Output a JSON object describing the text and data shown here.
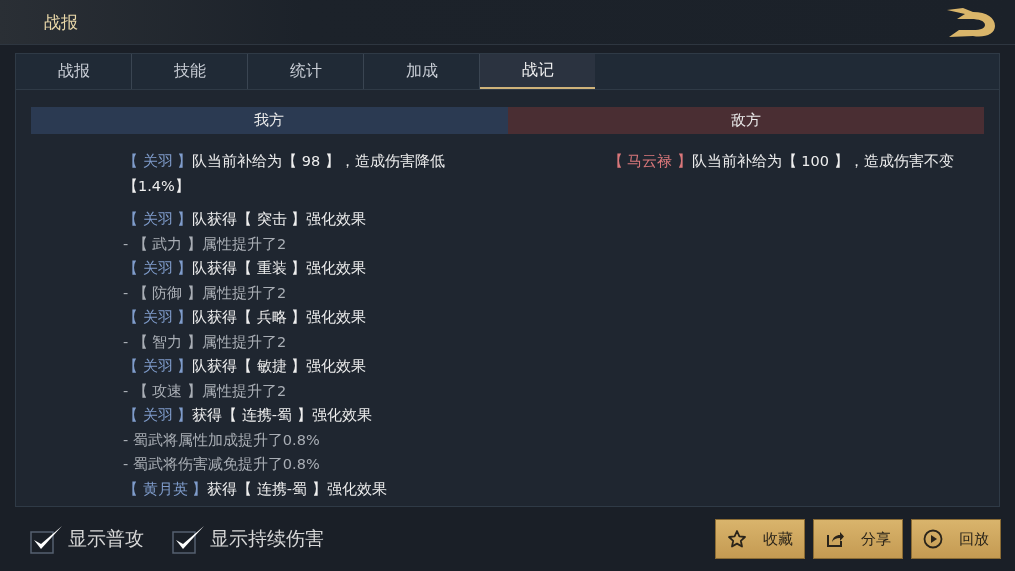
{
  "header": {
    "title": "战报"
  },
  "tabs": [
    {
      "label": "战报",
      "selected": false
    },
    {
      "label": "技能",
      "selected": false
    },
    {
      "label": "统计",
      "selected": false
    },
    {
      "label": "加成",
      "selected": false
    },
    {
      "label": "战记",
      "selected": true
    }
  ],
  "sides": [
    {
      "kind": "ally",
      "heading": "我方",
      "entries": [
        {
          "kind": "event",
          "name": "【 关羽 】",
          "text": "队当前补给为【 98 】，造成伤害降低【1.4%】"
        },
        {
          "kind": "event",
          "name": "【 关羽 】",
          "text": "队获得【 突击 】强化效果"
        },
        {
          "kind": "detail",
          "text": "- 【 武力 】属性提升了2"
        },
        {
          "kind": "event",
          "name": "【 关羽 】",
          "text": "队获得【 重装 】强化效果"
        },
        {
          "kind": "detail",
          "text": "- 【 防御 】属性提升了2"
        },
        {
          "kind": "event",
          "name": "【 关羽 】",
          "text": "队获得【 兵略 】强化效果"
        },
        {
          "kind": "detail",
          "text": "- 【 智力 】属性提升了2"
        },
        {
          "kind": "event",
          "name": "【 关羽 】",
          "text": "队获得【 敏捷 】强化效果"
        },
        {
          "kind": "detail",
          "text": "- 【 攻速 】属性提升了2"
        },
        {
          "kind": "event",
          "name": "【 关羽 】",
          "text": "获得【 连携-蜀 】强化效果"
        },
        {
          "kind": "detail",
          "text": "- 蜀武将属性加成提升了0.8%"
        },
        {
          "kind": "detail",
          "text": "- 蜀武将伤害减免提升了0.8%"
        },
        {
          "kind": "event",
          "name": "【 黄月英 】",
          "text": "获得【 连携-蜀 】强化效果"
        }
      ]
    },
    {
      "kind": "enemy",
      "heading": "敌方",
      "entries": [
        {
          "kind": "event",
          "name": "【 马云禄 】",
          "text": "队当前补给为【 100 】，造成伤害不变"
        }
      ]
    }
  ],
  "toggles": [
    {
      "label": "显示普攻",
      "checked": true
    },
    {
      "label": "显示持续伤害",
      "checked": true
    }
  ],
  "buttons": [
    {
      "kind": "star",
      "label": "收藏"
    },
    {
      "kind": "share",
      "label": "分享"
    },
    {
      "kind": "play",
      "label": "回放"
    }
  ]
}
